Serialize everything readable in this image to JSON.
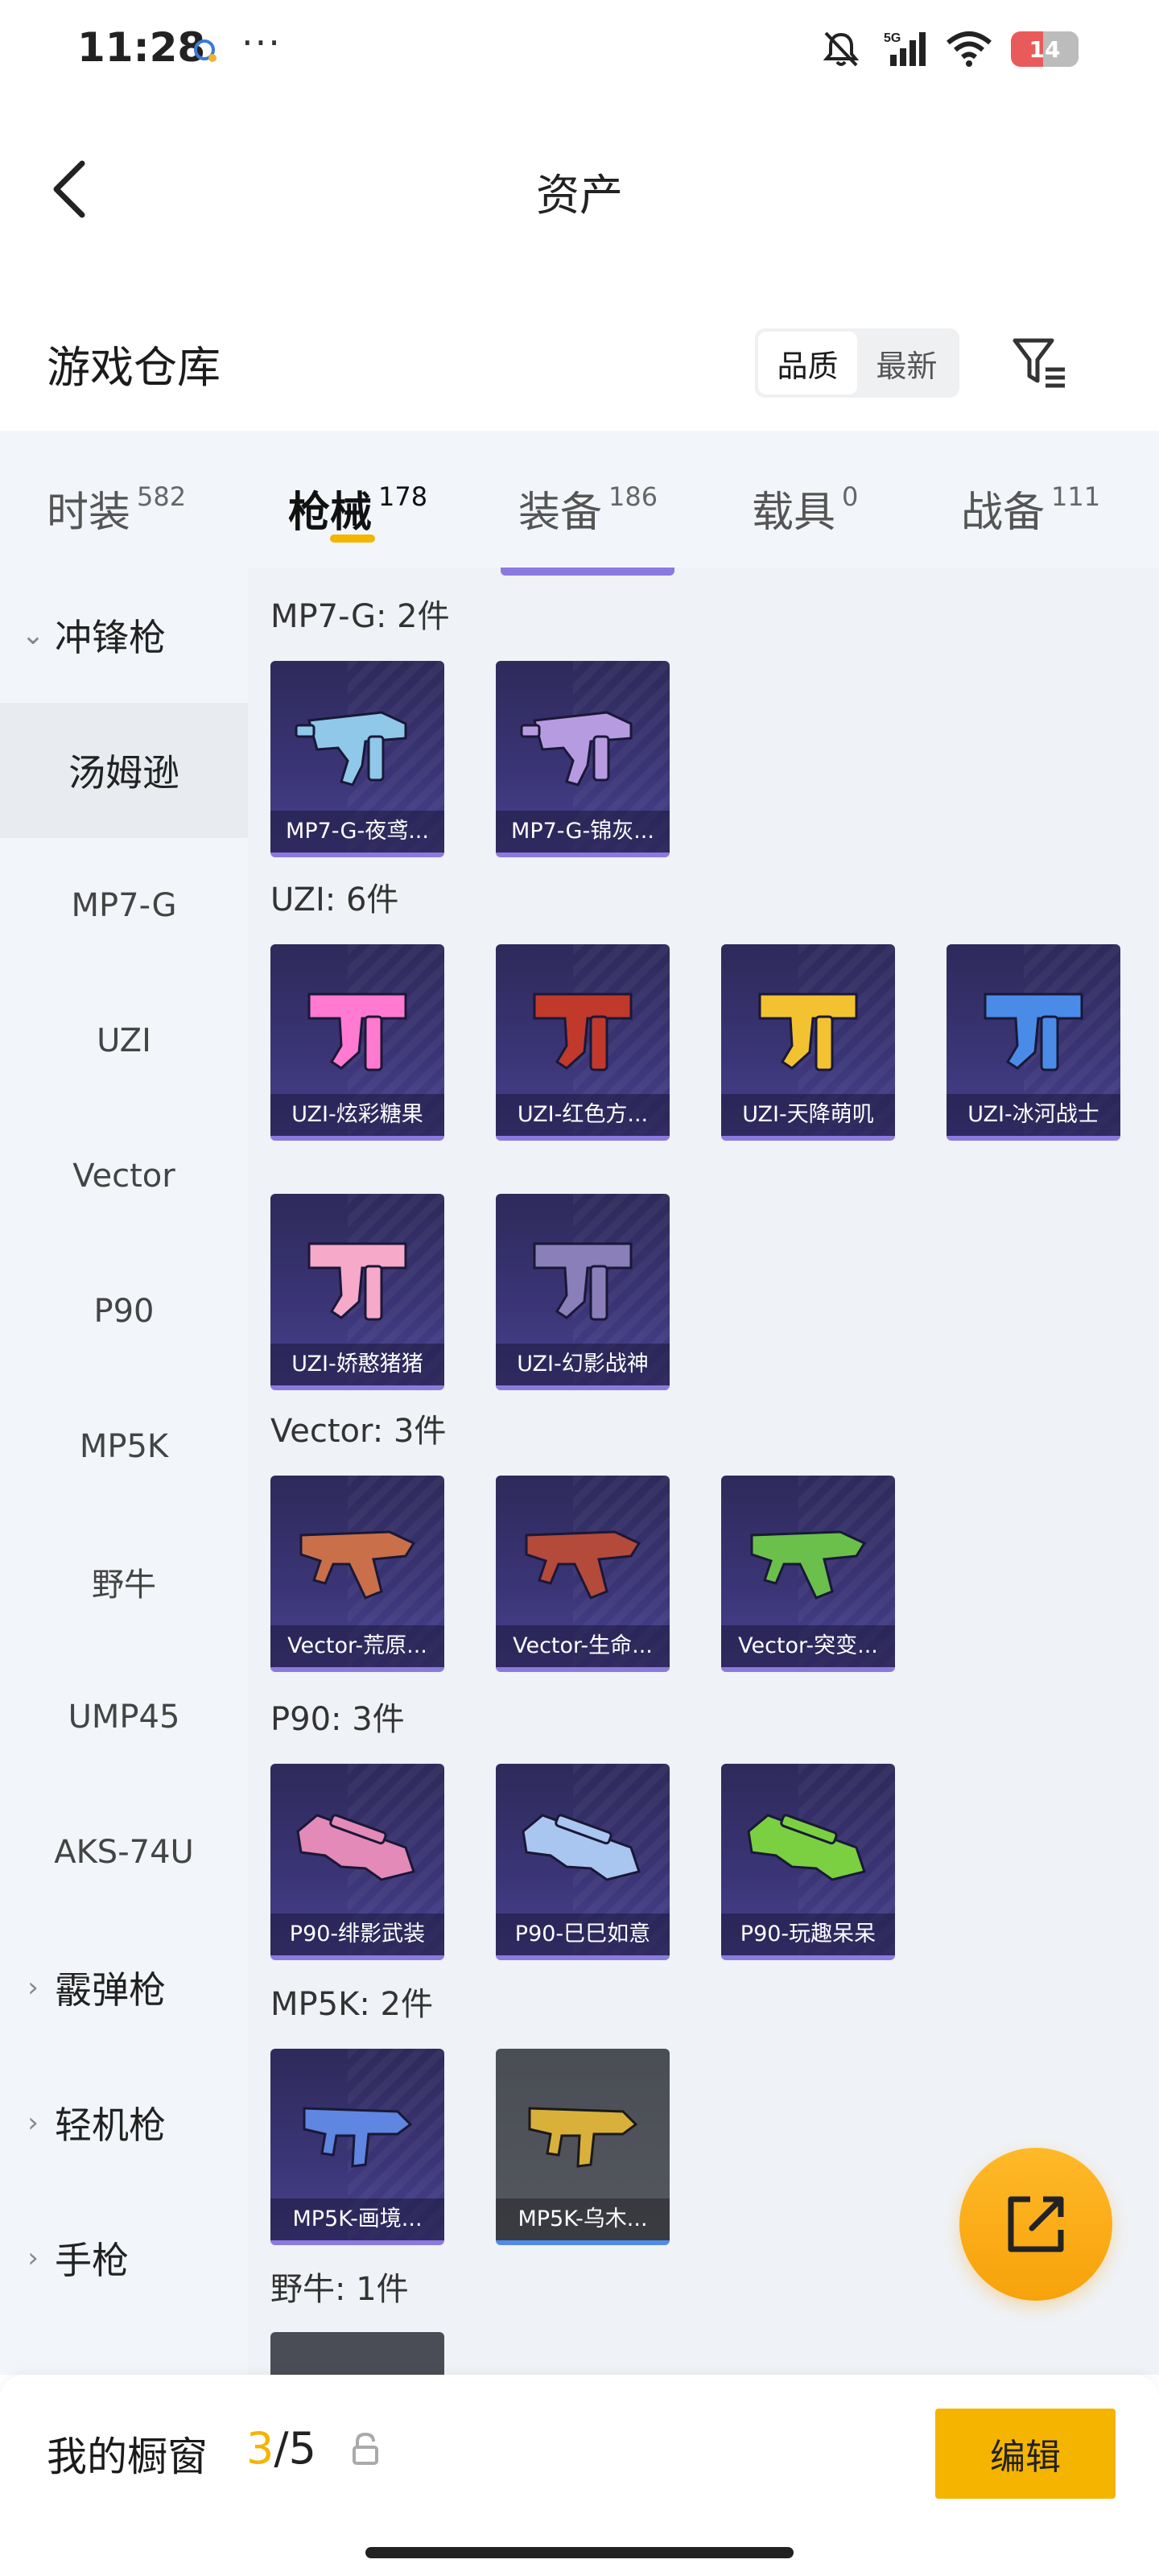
{
  "status_bar": {
    "time": "11:28",
    "network": "5G",
    "battery": "14"
  },
  "navbar": {
    "title": "资产"
  },
  "warehouse": {
    "title": "游戏仓库",
    "sort_options": [
      "品质",
      "最新"
    ],
    "active_sort": "品质"
  },
  "category_tabs": [
    {
      "label": "时装",
      "count": "582"
    },
    {
      "label": "枪械",
      "count": "178",
      "active": true
    },
    {
      "label": "装备",
      "count": "186"
    },
    {
      "label": "载具",
      "count": "0"
    },
    {
      "label": "战备",
      "count": "111"
    }
  ],
  "sidebar": {
    "items": [
      {
        "label": "冲锋枪",
        "type": "group",
        "expanded": true
      },
      {
        "label": "汤姆逊",
        "type": "sub",
        "selected": true
      },
      {
        "label": "MP7-G",
        "type": "sub"
      },
      {
        "label": "UZI",
        "type": "sub"
      },
      {
        "label": "Vector",
        "type": "sub"
      },
      {
        "label": "P90",
        "type": "sub"
      },
      {
        "label": "MP5K",
        "type": "sub"
      },
      {
        "label": "野牛",
        "type": "sub"
      },
      {
        "label": "UMP45",
        "type": "sub"
      },
      {
        "label": "AKS-74U",
        "type": "sub"
      },
      {
        "label": "霰弹枪",
        "type": "group",
        "expanded": false
      },
      {
        "label": "轻机枪",
        "type": "group",
        "expanded": false
      },
      {
        "label": "手枪",
        "type": "group",
        "expanded": false
      }
    ]
  },
  "groups": [
    {
      "title": "MP7-G: 2件",
      "items": [
        {
          "label": "MP7-G-夜鸢...",
          "color": "#8fc8e8"
        },
        {
          "label": "MP7-G-锦灰...",
          "color": "#b79be0"
        }
      ]
    },
    {
      "title": "UZI: 6件",
      "items": [
        {
          "label": "UZI-炫彩糖果",
          "color": "#ff7ad0"
        },
        {
          "label": "UZI-红色方...",
          "color": "#c0392b"
        },
        {
          "label": "UZI-天降萌叽",
          "color": "#f2c230"
        },
        {
          "label": "UZI-冰河战士",
          "color": "#4a8be8"
        },
        {
          "label": "UZI-娇憨猪猪",
          "color": "#f6a9c9"
        },
        {
          "label": "UZI-幻影战神",
          "color": "#8a7fb8"
        }
      ]
    },
    {
      "title": "Vector: 3件",
      "items": [
        {
          "label": "Vector-荒原...",
          "color": "#c9704a"
        },
        {
          "label": "Vector-生命...",
          "color": "#b44a3a"
        },
        {
          "label": "Vector-突变...",
          "color": "#6ac04a"
        }
      ]
    },
    {
      "title": "P90: 3件",
      "items": [
        {
          "label": "P90-绯影武装",
          "color": "#e48ab8"
        },
        {
          "label": "P90-巳巳如意",
          "color": "#a9c6f0"
        },
        {
          "label": "P90-玩趣呆呆",
          "color": "#7ad040"
        }
      ]
    },
    {
      "title": "MP5K: 2件",
      "items": [
        {
          "label": "MP5K-画境...",
          "color": "#5f86e0"
        },
        {
          "label": "MP5K-乌木...",
          "color": "#d9b13a",
          "gray": true
        }
      ]
    },
    {
      "title": "野牛: 1件",
      "items": []
    }
  ],
  "bottom_bar": {
    "title": "我的橱窗",
    "current": "3",
    "separator": "/",
    "total": "5",
    "edit_label": "编辑"
  },
  "colors": {
    "accent": "#f5b400",
    "card_bg": "#3b3577",
    "sidebar_bg": "#f2f6fa"
  }
}
